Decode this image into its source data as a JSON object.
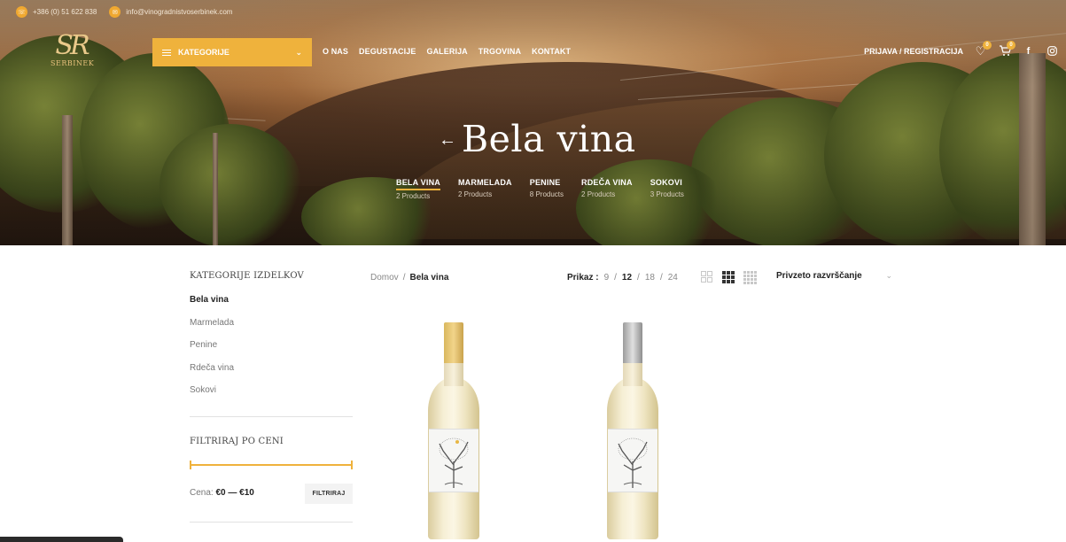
{
  "topbar": {
    "phone": "+386 (0) 51 622 838",
    "email": "info@vinogradnistvoserbinek.com"
  },
  "logo": {
    "word": "SERBINEK"
  },
  "category_button": {
    "label": "KATEGORIJE"
  },
  "nav": [
    "O NAS",
    "DEGUSTACIJE",
    "GALERIJA",
    "TRGOVINA",
    "KONTAKT"
  ],
  "account": {
    "login_label": "PRIJAVA / REGISTRACIJA",
    "wishlist_count": "0",
    "cart_count": "0"
  },
  "hero": {
    "title": "Bela vina",
    "subcategories": [
      {
        "name": "BELA VINA",
        "count": "2 Products"
      },
      {
        "name": "MARMELADA",
        "count": "2 Products"
      },
      {
        "name": "PENINE",
        "count": "8 Products"
      },
      {
        "name": "RDEČA VINA",
        "count": "2 Products"
      },
      {
        "name": "SOKOVI",
        "count": "3 Products"
      }
    ]
  },
  "sidebar": {
    "categories_title": "KATEGORIJE IZDELKOV",
    "categories": [
      "Bela vina",
      "Marmelada",
      "Penine",
      "Rdeča vina",
      "Sokovi"
    ],
    "filter_title": "FILTRIRAJ PO CENI",
    "price_label": "Cena:",
    "price_range": "€0 — €10",
    "filter_button": "FILTRIRAJ"
  },
  "main": {
    "breadcrumb": {
      "home": "Domov",
      "current": "Bela vina"
    },
    "perpage": {
      "label": "Prikaz :",
      "options": [
        "9",
        "12",
        "18",
        "24"
      ],
      "current": "12"
    },
    "sort": {
      "selected": "Privzeto razvrščanje"
    }
  },
  "colors": {
    "accent": "#efb23c"
  }
}
